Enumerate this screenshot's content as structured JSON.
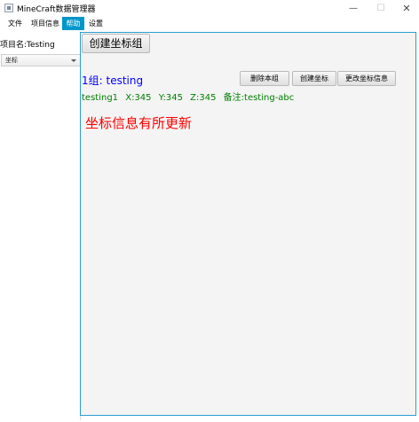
{
  "window": {
    "title": "MineCraft数据管理器",
    "controls": {
      "minimize": "—",
      "maximize": "☐",
      "close": "✕"
    }
  },
  "menu": {
    "items": [
      {
        "label": "文件"
      },
      {
        "label": "项目信息"
      },
      {
        "label": "帮助",
        "active": true
      },
      {
        "label": "设置"
      }
    ],
    "active_color": "#0096c9"
  },
  "sidebar": {
    "project_name": "项目名:Testing",
    "combo_value": "坐标"
  },
  "main": {
    "create_group_label": "创建坐标组",
    "group": {
      "title": "1组: testing",
      "buttons": {
        "delete": "删除本组",
        "create_coord": "创建坐标",
        "edit_coord": "更改坐标信息"
      },
      "coordinate": {
        "name": "testing1",
        "x": "X:345",
        "y": "Y:345",
        "z": "Z:345",
        "note": "备注:testing-abc"
      }
    },
    "status_message": "坐标信息有所更新"
  },
  "colors": {
    "group_title": "#0000ff",
    "coordinate_text": "#008000",
    "status_message": "#ff0000",
    "panel_border": "#2a9fd0"
  }
}
